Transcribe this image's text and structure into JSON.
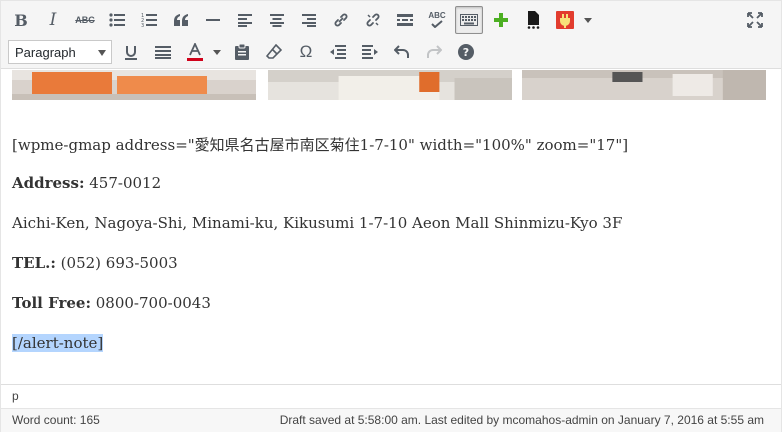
{
  "toolbar": {
    "format_select_value": "Paragraph",
    "abc_label": "ABC",
    "abc_check_label": "ABC"
  },
  "content": {
    "shortcode": "[wpme-gmap address=\"愛知県名古屋市南区菊住1-7-10\" width=\"100%\" zoom=\"17\"]",
    "address_label": "Address:",
    "address_value": " 457-0012",
    "address_line": "Aichi-Ken, Nagoya-Shi, Minami-ku, Kikusumi 1-7-10 Aeon Mall Shinmizu-Kyo 3F",
    "tel_label": "TEL.:",
    "tel_value": " (052) 693-5003",
    "tollfree_label": "Toll Free:",
    "tollfree_value": " 0800-700-0043",
    "closing_tag": "[/alert-note]"
  },
  "status": {
    "path": "p",
    "word_count": "Word count: 165",
    "draft_info": "Draft saved at 5:58:00 am. Last edited by mcomahos-admin on January 7, 2016 at 5:55 am"
  },
  "colors": {
    "text_color_indicator": "#d0021b",
    "add_icon_green": "#4caf22",
    "plugin_icon_red": "#e23c2e"
  }
}
